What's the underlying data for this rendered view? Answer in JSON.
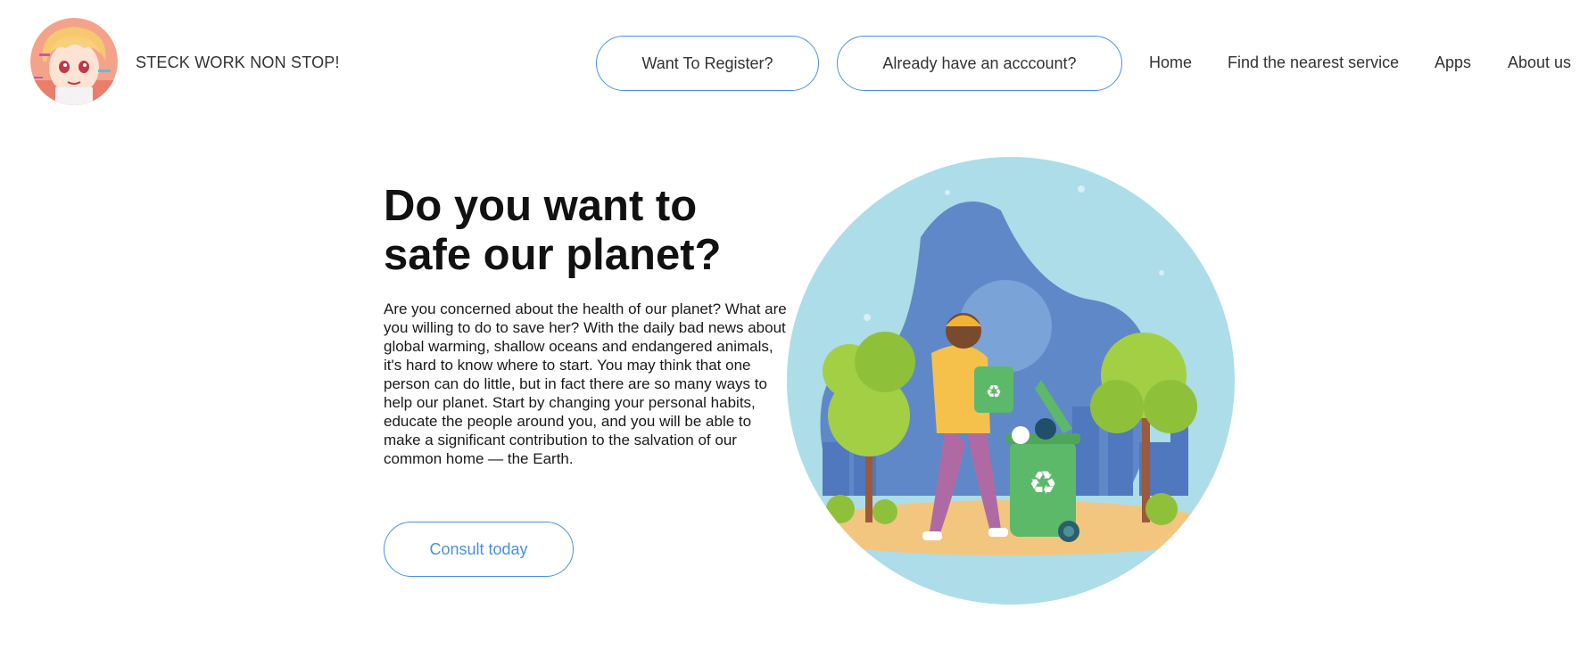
{
  "header": {
    "brand_name": "STECK WORK NON STOP!",
    "register_label": "Want To Register?",
    "login_label": "Already have an acccount?",
    "nav": {
      "home": "Home",
      "find": "Find the nearest service",
      "apps": "Apps",
      "about": "About us"
    },
    "accent_color": "#4a90e2"
  },
  "hero": {
    "title_line1": "Do you want to",
    "title_line2": "safe our planet?",
    "description": "Are you concerned about the health of our planet? What are you willing to do to save her? With the daily bad news about global warming, shallow oceans and endangered animals, it's hard to know where to start. You may think that one person can do little, but in fact there are so many ways to help our planet. Start by changing your personal habits, educate the people around you, and you will be able to make a significant contribution to the salvation of our common home — the Earth.",
    "cta_label": "Consult today",
    "illustration": "recycling-person-illustration"
  },
  "icons": {
    "logo": "anime-avatar-logo",
    "recycle": "recycle-icon"
  }
}
